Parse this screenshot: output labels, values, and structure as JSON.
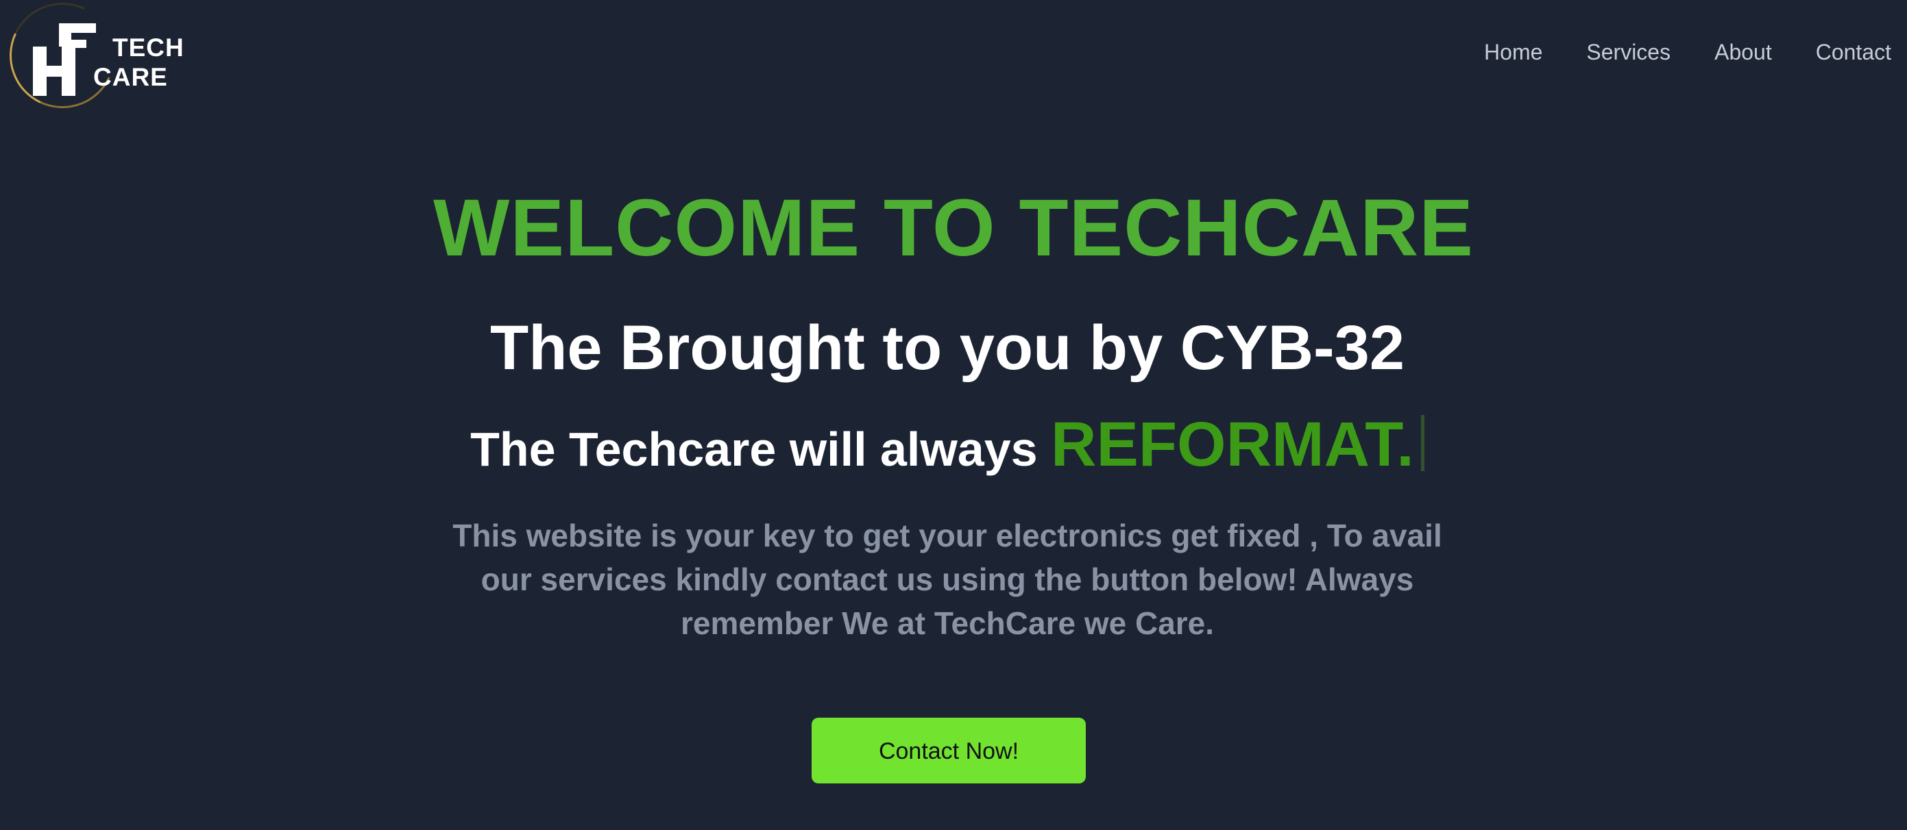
{
  "brand": {
    "logo_text_line1": "TECH",
    "logo_text_line2": "CARE",
    "logo_monogram": "HF",
    "ring_color": "#c9a64a"
  },
  "nav": {
    "items": [
      {
        "label": "Home"
      },
      {
        "label": "Services"
      },
      {
        "label": "About"
      },
      {
        "label": "Contact"
      }
    ]
  },
  "hero": {
    "title": "WELCOME TO TECHCARE",
    "subtitle": "The Brought to you by CYB-32",
    "tagline_prefix": "The Techcare will always",
    "typed_word": "REFORMAT.",
    "description": "This website is your key to get your electronics get fixed , To avail our services kindly contact us using the button below! Always remember We at TechCare we Care.",
    "cta_label": "Contact Now!"
  },
  "colors": {
    "background": "#1c2333",
    "accent_green": "#4fae34",
    "typed_green": "#3c9a16",
    "button_green": "#72e32f",
    "nav_text": "#c7ccd6",
    "muted_text": "#8a93a3"
  }
}
